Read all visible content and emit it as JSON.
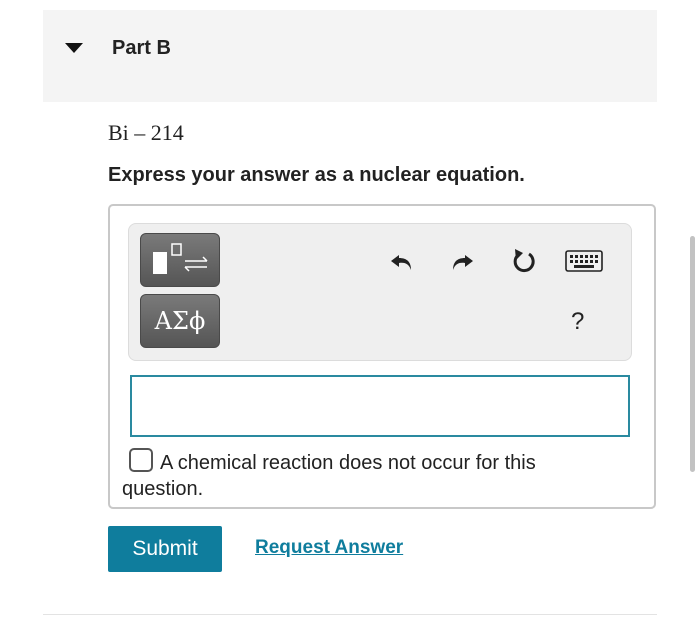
{
  "part": {
    "title": "Part B"
  },
  "question": {
    "element": "Bi – 214",
    "instruction": "Express your answer as a nuclear equation."
  },
  "toolbar": {
    "greek_label": "ΑΣϕ",
    "help_label": "?",
    "icons": [
      "templates-icon",
      "undo-icon",
      "redo-icon",
      "reset-icon",
      "keyboard-icon"
    ]
  },
  "answer": {
    "value": "",
    "placeholder": ""
  },
  "option": {
    "label": "A chemical reaction does not occur for this question."
  },
  "actions": {
    "submit_label": "Submit",
    "request_label": "Request Answer"
  },
  "colors": {
    "accent": "#0f7d9d",
    "input_border": "#2a8aa0",
    "header_bg": "#f4f4f4"
  }
}
